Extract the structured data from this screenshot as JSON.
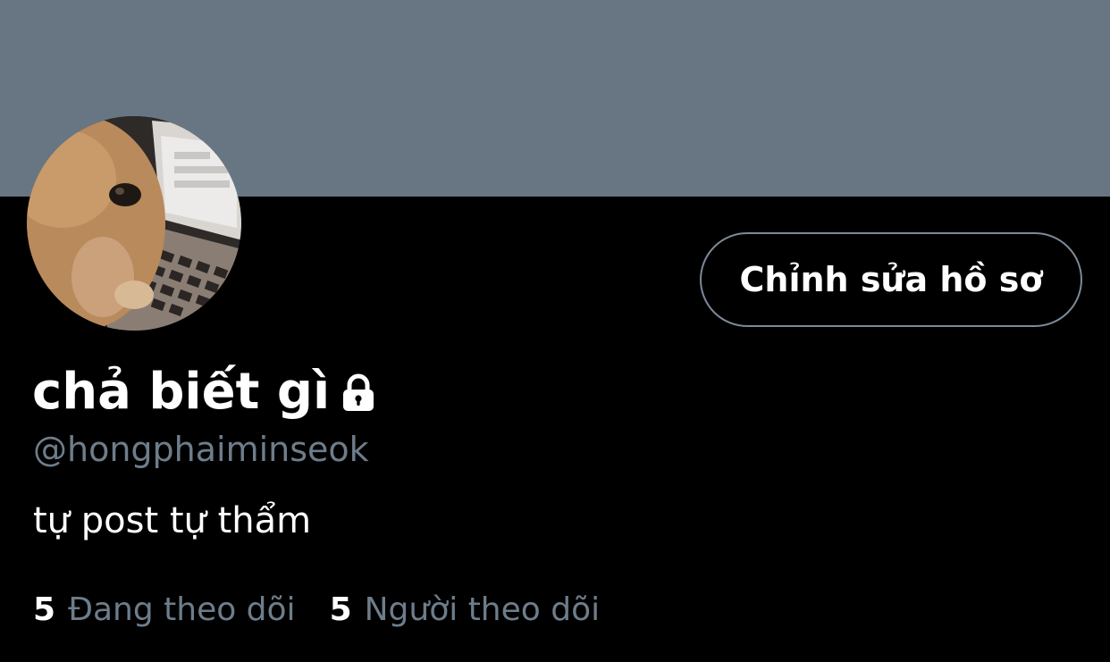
{
  "profile": {
    "display_name": "chả biết gì",
    "handle": "@hongphaiminseok",
    "bio": "tự post tự thẩm",
    "protected_icon": "lock-icon"
  },
  "actions": {
    "edit_profile_label": "Chỉnh sửa hồ sơ"
  },
  "stats": {
    "following_count": "5",
    "following_label": "Đang theo dõi",
    "followers_count": "5",
    "followers_label": "Người theo dõi"
  },
  "colors": {
    "banner": "#687684",
    "background": "#000000",
    "secondary_text": "#6e7d8b",
    "primary_text": "#ffffff"
  }
}
